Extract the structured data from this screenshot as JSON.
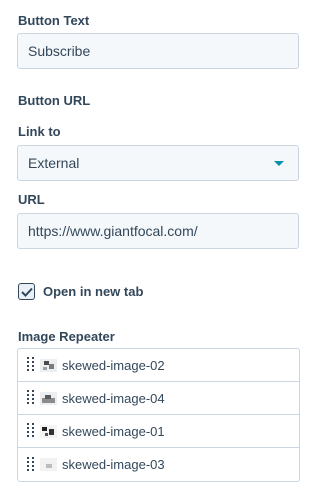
{
  "button_text": {
    "label": "Button Text",
    "value": "Subscribe"
  },
  "button_url": {
    "heading": "Button URL"
  },
  "link_to": {
    "label": "Link to",
    "selected": "External"
  },
  "url": {
    "label": "URL",
    "value": "https://www.giantfocal.com/"
  },
  "open_new_tab": {
    "label": "Open in new tab",
    "checked": true
  },
  "image_repeater": {
    "label": "Image Repeater",
    "items": [
      {
        "name": "skewed-image-02"
      },
      {
        "name": "skewed-image-04"
      },
      {
        "name": "skewed-image-01"
      },
      {
        "name": "skewed-image-03"
      }
    ]
  },
  "colors": {
    "accent": "#0091ae",
    "text": "#33475b",
    "border": "#cbd6e2",
    "field_bg": "#f5f8fa"
  }
}
